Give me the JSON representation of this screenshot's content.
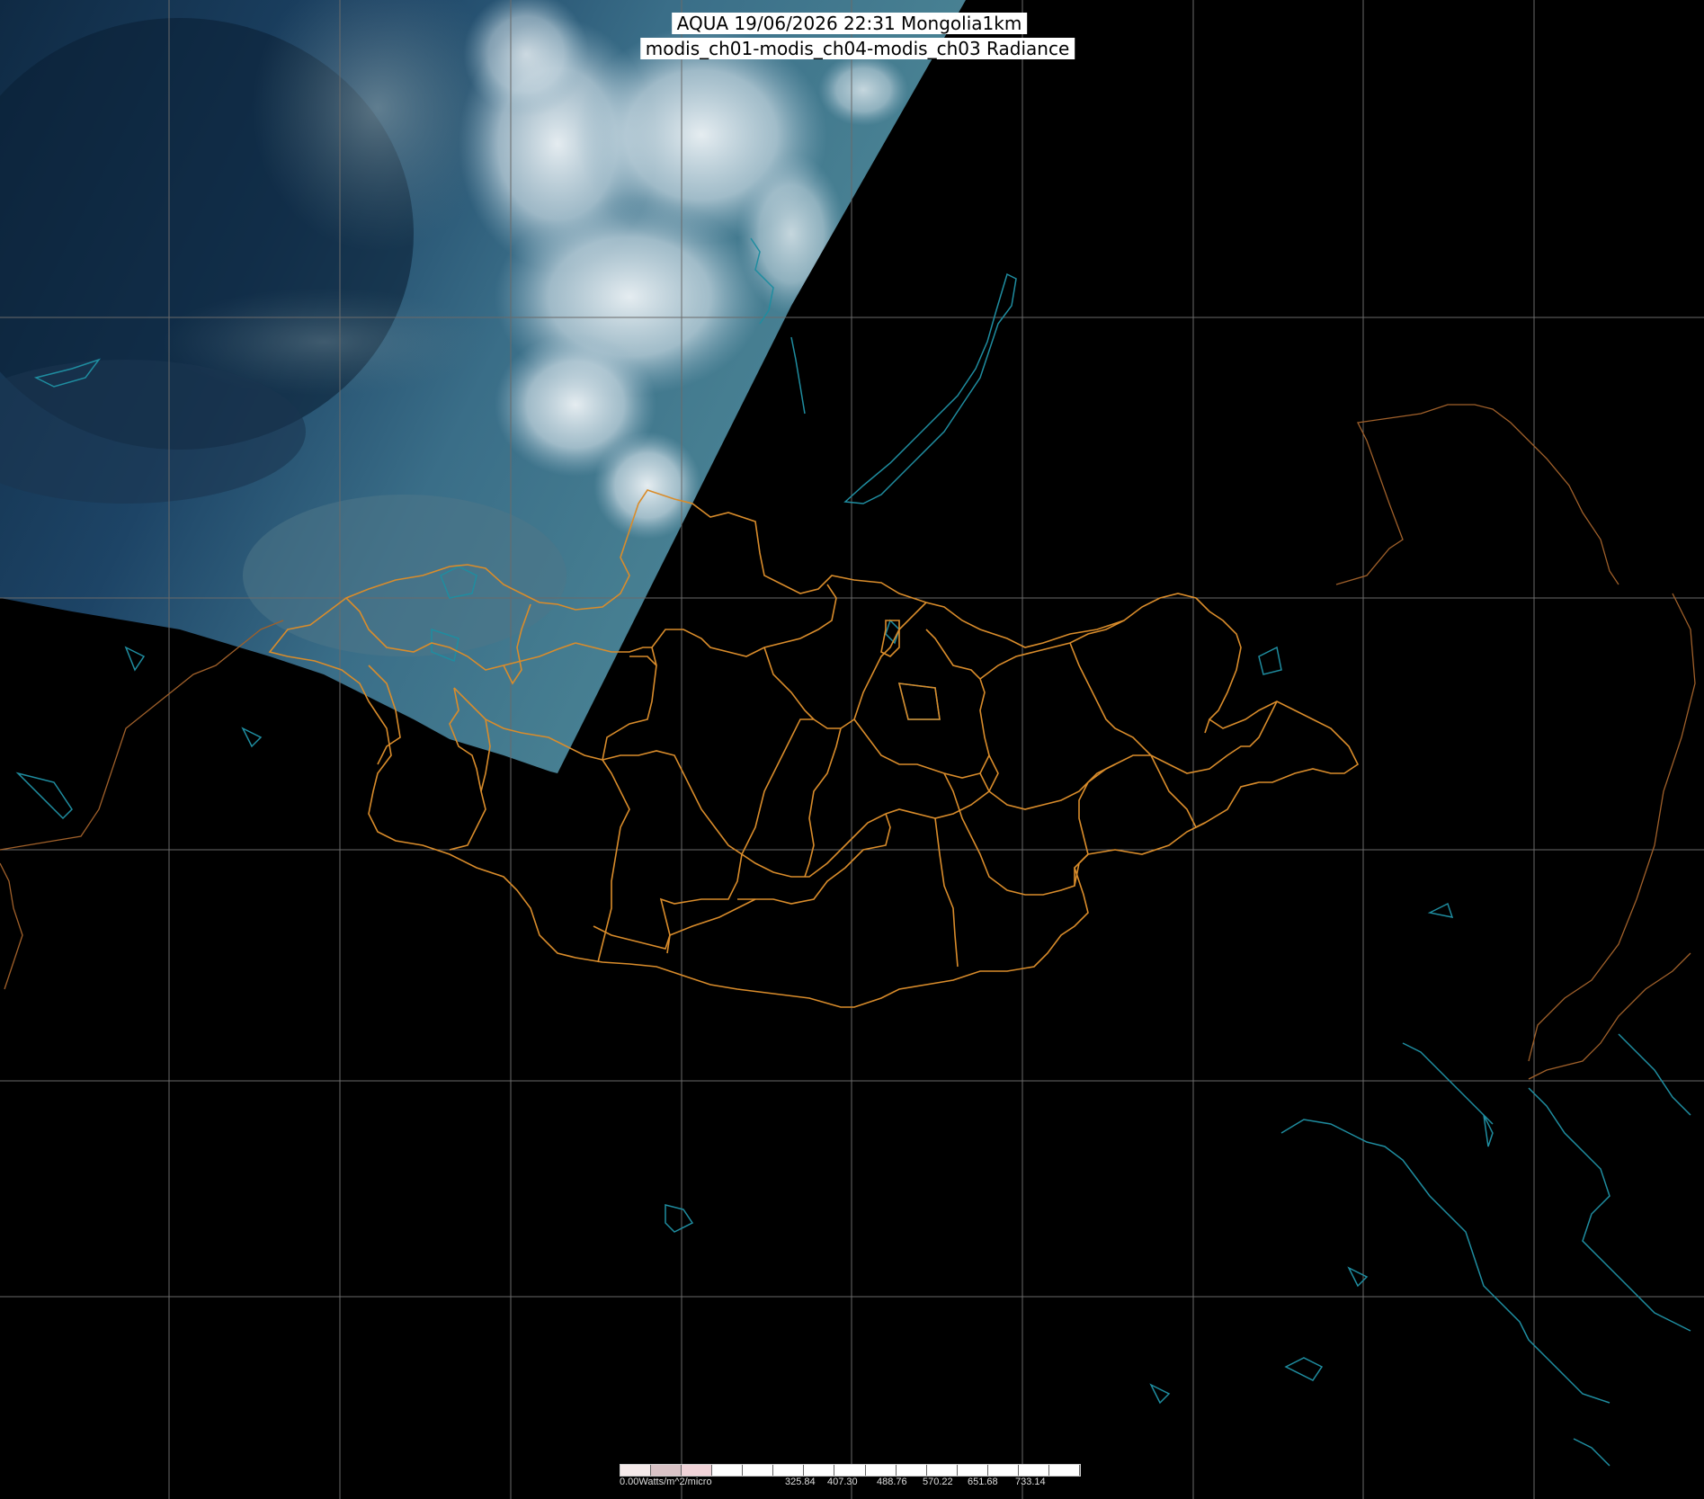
{
  "title": {
    "line1": "AQUA 19/06/2026 22:31 Mongolia1km",
    "line2": "modis_ch01-modis_ch04-modis_ch03 Radiance"
  },
  "scale": {
    "unit_label": "0.00Watts/m^2/micro",
    "ticks": [
      "325.84",
      "407.30",
      "488.76",
      "570.22",
      "651.68",
      "733.14"
    ],
    "colors": [
      "#f5eaea",
      "#d9c3c6",
      "#f0d3d8",
      "#ffffff",
      "#ffffff",
      "#ffffff",
      "#ffffff",
      "#ffffff",
      "#ffffff",
      "#ffffff",
      "#ffffff",
      "#ffffff",
      "#ffffff",
      "#ffffff",
      "#ffffff"
    ]
  },
  "colors": {
    "border": "#d98c2b",
    "coast": "#1f8da0",
    "grid": "#6a6a6a",
    "foreign_border": "#a0602a"
  },
  "layers": [
    "satellite-swath",
    "lat-lon-grid",
    "admin-boundaries",
    "coastlines-lakes"
  ]
}
